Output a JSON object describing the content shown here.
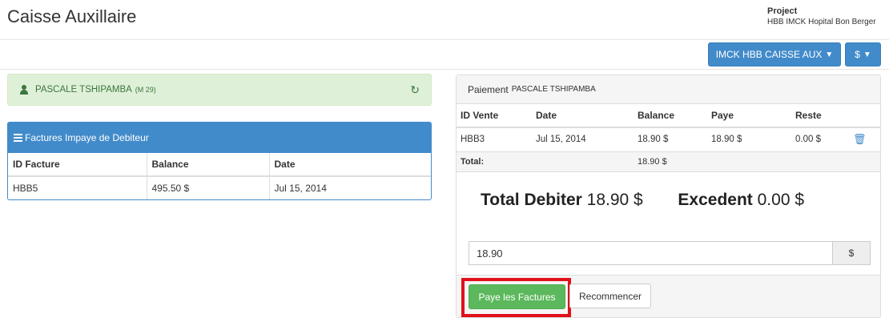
{
  "header": {
    "title": "Caisse Auxillaire",
    "project_label": "Project",
    "project_value": "HBB IMCK Hopital Bon Berger"
  },
  "toolbar": {
    "caisse_label": "IMCK HBB CAISSE AUX",
    "currency_label": "$"
  },
  "client": {
    "name": "PASCALE TSHIPAMBA",
    "meta": "(M 29)"
  },
  "invoices": {
    "title": "Factures Impaye de Debiteur",
    "columns": [
      "ID Facture",
      "Balance",
      "Date"
    ],
    "rows": [
      [
        "HBB5",
        "495.50 $",
        "Jul 15, 2014"
      ]
    ]
  },
  "payment": {
    "title": "Paiement",
    "payer": "PASCALE TSHIPAMBA",
    "columns": [
      "ID Vente",
      "Date",
      "Balance",
      "Paye",
      "Reste"
    ],
    "rows": [
      [
        "HBB3",
        "Jul 15, 2014",
        "18.90 $",
        "18.90 $",
        "0.00 $"
      ]
    ],
    "total_label": "Total:",
    "total_balance": "18.90 $",
    "total_debit_label": "Total Debiter",
    "total_debit_value": "18.90 $",
    "excedent_label": "Excedent",
    "excedent_value": "0.00 $",
    "amount_value": "18.90",
    "amount_addon": "$",
    "pay_button": "Paye les Factures",
    "reset_button": "Recommencer"
  },
  "colors": {
    "primary": "#428bca",
    "success": "#5cb85c",
    "alert_success_bg": "#dff0d8",
    "highlight": "#e0111b"
  },
  "icons": {
    "user": "user-icon",
    "refresh": "refresh-icon",
    "list": "list-icon",
    "trash": "trash-icon",
    "caret": "caret-down-icon"
  }
}
